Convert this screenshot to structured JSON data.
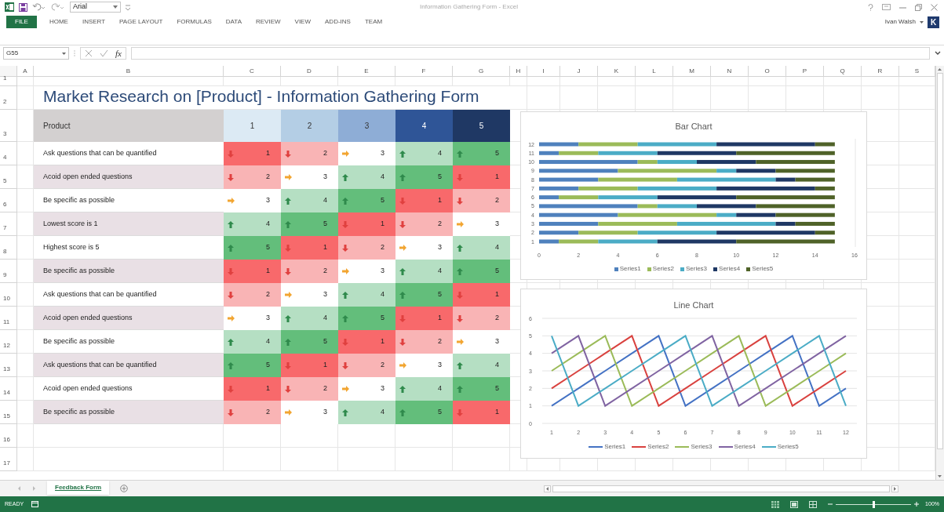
{
  "window": {
    "title": "Information Gathering Form - Excel",
    "font_box": "Arial",
    "user": "Ivan Walsh",
    "avatar": "K"
  },
  "ribbon_tabs": [
    {
      "label": "FILE",
      "kind": "file"
    },
    {
      "label": "HOME",
      "kind": "tab"
    },
    {
      "label": "INSERT",
      "kind": "tab"
    },
    {
      "label": "PAGE LAYOUT",
      "kind": "tab"
    },
    {
      "label": "FORMULAS",
      "kind": "tab"
    },
    {
      "label": "DATA",
      "kind": "tab"
    },
    {
      "label": "REVIEW",
      "kind": "tab"
    },
    {
      "label": "VIEW",
      "kind": "tab"
    },
    {
      "label": "ADD-INS",
      "kind": "tab"
    },
    {
      "label": "TEAM",
      "kind": "tab"
    }
  ],
  "formula_bar": {
    "name_box": "G55",
    "fx": "fx"
  },
  "sheet": {
    "columns": [
      "A",
      "B",
      "C",
      "D",
      "E",
      "F",
      "G",
      "H",
      "I",
      "J",
      "K",
      "L",
      "M",
      "N",
      "O",
      "P",
      "Q",
      "R",
      "S"
    ],
    "rows": [
      "1",
      "2",
      "3",
      "4",
      "5",
      "6",
      "7",
      "8",
      "9",
      "10",
      "11",
      "12",
      "13",
      "14",
      "15",
      "16",
      "17"
    ],
    "title": "Market Research on [Product] - Information Gathering Form",
    "table": {
      "corner": "Product",
      "columns": [
        {
          "label": "1",
          "color": "#dceaf4"
        },
        {
          "label": "2",
          "color": "#b4cee5"
        },
        {
          "label": "3",
          "color": "#8eadd6"
        },
        {
          "label": "4",
          "color": "#2f5597"
        },
        {
          "label": "5",
          "color": "#1f3864"
        }
      ],
      "rows": [
        {
          "label": "Ask questions that can be quantified",
          "shaded": false,
          "cells": [
            {
              "text": "1",
              "color": "#f8696b",
              "kind": "down"
            },
            {
              "text": "2",
              "color": "#f9b4b5",
              "kind": "down"
            },
            {
              "text": "3",
              "color": "#ffffff",
              "kind": "right"
            },
            {
              "text": "4",
              "color": "#b5dfc3",
              "kind": "up"
            },
            {
              "text": "5",
              "color": "#63be7b",
              "kind": "up"
            }
          ]
        },
        {
          "label": "Acoid open ended questions",
          "shaded": true,
          "cells": [
            {
              "text": "2",
              "color": "#f9b4b5",
              "kind": "down"
            },
            {
              "text": "3",
              "color": "#ffffff",
              "kind": "right"
            },
            {
              "text": "4",
              "color": "#b5dfc3",
              "kind": "up"
            },
            {
              "text": "5",
              "color": "#63be7b",
              "kind": "up"
            },
            {
              "text": "1",
              "color": "#f8696b",
              "kind": "down"
            }
          ]
        },
        {
          "label": "Be specific as possible",
          "shaded": false,
          "cells": [
            {
              "text": "3",
              "color": "#ffffff",
              "kind": "right"
            },
            {
              "text": "4",
              "color": "#b5dfc3",
              "kind": "up"
            },
            {
              "text": "5",
              "color": "#63be7b",
              "kind": "up"
            },
            {
              "text": "1",
              "color": "#f8696b",
              "kind": "down"
            },
            {
              "text": "2",
              "color": "#f9b4b5",
              "kind": "down"
            }
          ]
        },
        {
          "label": "Lowest score is 1",
          "shaded": true,
          "cells": [
            {
              "text": "4",
              "color": "#b5dfc3",
              "kind": "up"
            },
            {
              "text": "5",
              "color": "#63be7b",
              "kind": "up"
            },
            {
              "text": "1",
              "color": "#f8696b",
              "kind": "down"
            },
            {
              "text": "2",
              "color": "#f9b4b5",
              "kind": "down"
            },
            {
              "text": "3",
              "color": "#ffffff",
              "kind": "right"
            }
          ]
        },
        {
          "label": "Highest score is 5",
          "shaded": false,
          "cells": [
            {
              "text": "5",
              "color": "#63be7b",
              "kind": "up"
            },
            {
              "text": "1",
              "color": "#f8696b",
              "kind": "down"
            },
            {
              "text": "2",
              "color": "#f9b4b5",
              "kind": "down"
            },
            {
              "text": "3",
              "color": "#ffffff",
              "kind": "right"
            },
            {
              "text": "4",
              "color": "#b5dfc3",
              "kind": "up"
            }
          ]
        },
        {
          "label": "Be specific as possible",
          "shaded": true,
          "cells": [
            {
              "text": "1",
              "color": "#f8696b",
              "kind": "down"
            },
            {
              "text": "2",
              "color": "#f9b4b5",
              "kind": "down"
            },
            {
              "text": "3",
              "color": "#ffffff",
              "kind": "right"
            },
            {
              "text": "4",
              "color": "#b5dfc3",
              "kind": "up"
            },
            {
              "text": "5",
              "color": "#63be7b",
              "kind": "up"
            }
          ]
        },
        {
          "label": "Ask questions that can be quantified",
          "shaded": false,
          "cells": [
            {
              "text": "2",
              "color": "#f9b4b5",
              "kind": "down"
            },
            {
              "text": "3",
              "color": "#ffffff",
              "kind": "right"
            },
            {
              "text": "4",
              "color": "#b5dfc3",
              "kind": "up"
            },
            {
              "text": "5",
              "color": "#63be7b",
              "kind": "up"
            },
            {
              "text": "1",
              "color": "#f8696b",
              "kind": "down"
            }
          ]
        },
        {
          "label": "Acoid open ended questions",
          "shaded": true,
          "cells": [
            {
              "text": "3",
              "color": "#ffffff",
              "kind": "right"
            },
            {
              "text": "4",
              "color": "#b5dfc3",
              "kind": "up"
            },
            {
              "text": "5",
              "color": "#63be7b",
              "kind": "up"
            },
            {
              "text": "1",
              "color": "#f8696b",
              "kind": "down"
            },
            {
              "text": "2",
              "color": "#f9b4b5",
              "kind": "down"
            }
          ]
        },
        {
          "label": "Be specific as possible",
          "shaded": false,
          "cells": [
            {
              "text": "4",
              "color": "#b5dfc3",
              "kind": "up"
            },
            {
              "text": "5",
              "color": "#63be7b",
              "kind": "up"
            },
            {
              "text": "1",
              "color": "#f8696b",
              "kind": "down"
            },
            {
              "text": "2",
              "color": "#f9b4b5",
              "kind": "down"
            },
            {
              "text": "3",
              "color": "#ffffff",
              "kind": "right"
            }
          ]
        },
        {
          "label": "Ask questions that can be quantified",
          "shaded": true,
          "cells": [
            {
              "text": "5",
              "color": "#63be7b",
              "kind": "up"
            },
            {
              "text": "1",
              "color": "#f8696b",
              "kind": "down"
            },
            {
              "text": "2",
              "color": "#f9b4b5",
              "kind": "down"
            },
            {
              "text": "3",
              "color": "#ffffff",
              "kind": "right"
            },
            {
              "text": "4",
              "color": "#b5dfc3",
              "kind": "up"
            }
          ]
        },
        {
          "label": "Acoid open ended questions",
          "shaded": false,
          "cells": [
            {
              "text": "1",
              "color": "#f8696b",
              "kind": "down"
            },
            {
              "text": "2",
              "color": "#f9b4b5",
              "kind": "down"
            },
            {
              "text": "3",
              "color": "#ffffff",
              "kind": "right"
            },
            {
              "text": "4",
              "color": "#b5dfc3",
              "kind": "up"
            },
            {
              "text": "5",
              "color": "#63be7b",
              "kind": "up"
            }
          ]
        },
        {
          "label": "Be specific as possible",
          "shaded": true,
          "cells": [
            {
              "text": "2",
              "color": "#f9b4b5",
              "kind": "down"
            },
            {
              "text": "3",
              "color": "#ffffff",
              "kind": "right"
            },
            {
              "text": "4",
              "color": "#b5dfc3",
              "kind": "up"
            },
            {
              "text": "5",
              "color": "#63be7b",
              "kind": "up"
            },
            {
              "text": "1",
              "color": "#f8696b",
              "kind": "down"
            }
          ]
        }
      ]
    }
  },
  "bar_chart": {
    "chart_data": {
      "type": "bar",
      "title": "Bar Chart",
      "orientation": "horizontal",
      "stacked": true,
      "legend": "bottom",
      "categories": [
        "12",
        "11",
        "10",
        "9",
        "8",
        "7",
        "6",
        "5",
        "4",
        "3",
        "2",
        "1"
      ],
      "series": [
        {
          "name": "Series1",
          "color": "#4f81bd",
          "values": [
            2,
            1,
            5,
            4,
            3,
            2,
            1,
            5,
            4,
            3,
            2,
            1
          ]
        },
        {
          "name": "Series2",
          "color": "#9bbb59",
          "values": [
            3,
            2,
            1,
            5,
            4,
            3,
            2,
            1,
            5,
            4,
            3,
            2
          ]
        },
        {
          "name": "Series3",
          "color": "#4bacc6",
          "values": [
            4,
            3,
            2,
            1,
            5,
            4,
            3,
            2,
            1,
            5,
            4,
            3
          ]
        },
        {
          "name": "Series4",
          "color": "#1f3864",
          "values": [
            5,
            4,
            3,
            2,
            1,
            5,
            4,
            3,
            2,
            1,
            5,
            4
          ]
        },
        {
          "name": "Series5",
          "color": "#4f6228",
          "values": [
            1,
            5,
            4,
            3,
            2,
            1,
            5,
            4,
            3,
            2,
            1,
            5
          ]
        }
      ],
      "xlim": [
        0,
        16
      ],
      "xticks": [
        0,
        2,
        4,
        6,
        8,
        10,
        12,
        14,
        16
      ]
    }
  },
  "line_chart": {
    "chart_data": {
      "type": "line",
      "title": "Line Chart",
      "legend": "bottom",
      "grid": true,
      "x": [
        1,
        2,
        3,
        4,
        5,
        6,
        7,
        8,
        9,
        10,
        11,
        12
      ],
      "series": [
        {
          "name": "Series1",
          "color": "#4472c4",
          "values": [
            1,
            2,
            3,
            4,
            5,
            1,
            2,
            3,
            4,
            5,
            1,
            2
          ]
        },
        {
          "name": "Series2",
          "color": "#d9423f",
          "values": [
            2,
            3,
            4,
            5,
            1,
            2,
            3,
            4,
            5,
            1,
            2,
            3
          ]
        },
        {
          "name": "Series3",
          "color": "#9bbb59",
          "values": [
            3,
            4,
            5,
            1,
            2,
            3,
            4,
            5,
            1,
            2,
            3,
            4
          ]
        },
        {
          "name": "Series4",
          "color": "#8064a2",
          "values": [
            4,
            5,
            1,
            2,
            3,
            4,
            5,
            1,
            2,
            3,
            4,
            5
          ]
        },
        {
          "name": "Series5",
          "color": "#4bacc6",
          "values": [
            5,
            1,
            2,
            3,
            4,
            5,
            1,
            2,
            3,
            4,
            5,
            1
          ]
        }
      ],
      "ylim": [
        0,
        6
      ],
      "yticks": [
        0,
        1,
        2,
        3,
        4,
        5,
        6
      ]
    }
  },
  "sheet_tabs": [
    {
      "label": "Feedback Form",
      "selected": true
    }
  ],
  "status_bar": {
    "status": "READY",
    "zoom_slider": {
      "level": 0.5
    },
    "zoom": "100%"
  }
}
